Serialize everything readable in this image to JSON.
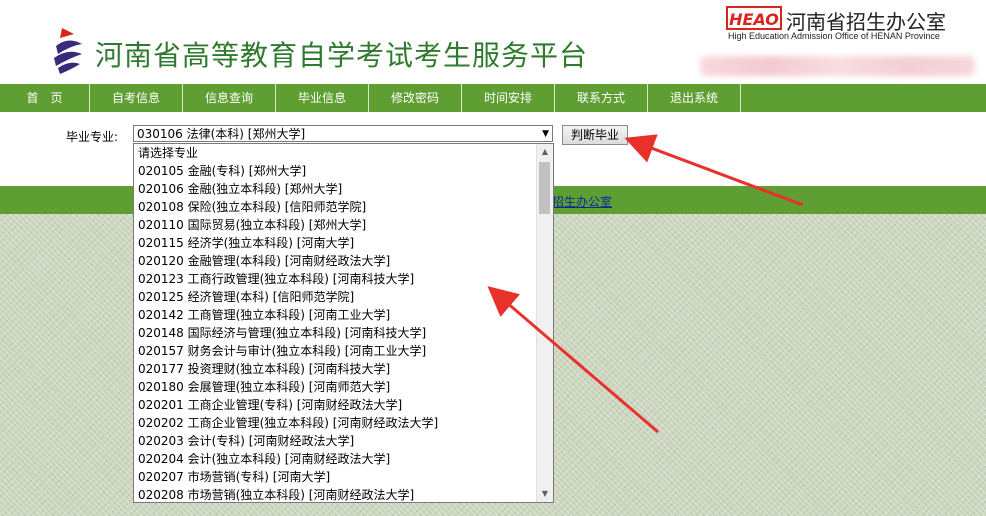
{
  "header": {
    "site_title": "河南省高等教育自学考试考生服务平台",
    "office_logo_text": "HEAO",
    "office_name_cn": "河南省招生办公室",
    "office_name_en": "High Education Admission Office of HENAN Province"
  },
  "nav": [
    {
      "label": "首　页",
      "width": 90
    },
    {
      "label": "自考信息",
      "width": 93
    },
    {
      "label": "信息查询",
      "width": 93
    },
    {
      "label": "毕业信息",
      "width": 93
    },
    {
      "label": "修改密码",
      "width": 93
    },
    {
      "label": "时间安排",
      "width": 93
    },
    {
      "label": "联系方式",
      "width": 93
    },
    {
      "label": "退出系统",
      "width": 93
    }
  ],
  "form": {
    "label": "毕业专业:",
    "selected_value": "030106 法律(本科) [郑州大学]",
    "judge_button": "判断毕业"
  },
  "footer": {
    "link_text": "招生办公室"
  },
  "dropdown_options": [
    "请选择专业",
    "020105 金融(专科) [郑州大学]",
    "020106 金融(独立本科段) [郑州大学]",
    "020108 保险(独立本科段) [信阳师范学院]",
    "020110 国际贸易(独立本科段) [郑州大学]",
    "020115 经济学(独立本科段) [河南大学]",
    "020120 金融管理(本科段) [河南财经政法大学]",
    "020123 工商行政管理(独立本科段) [河南科技大学]",
    "020125 经济管理(本科) [信阳师范学院]",
    "020142 工商管理(独立本科段) [河南工业大学]",
    "020148 国际经济与管理(独立本科段) [河南科技大学]",
    "020157 财务会计与审计(独立本科段) [河南工业大学]",
    "020177 投资理财(独立本科段) [河南科技大学]",
    "020180 会展管理(独立本科段) [河南师范大学]",
    "020201 工商企业管理(专科) [河南财经政法大学]",
    "020202 工商企业管理(独立本科段) [河南财经政法大学]",
    "020203 会计(专科) [河南财经政法大学]",
    "020204 会计(独立本科段) [河南财经政法大学]",
    "020207 市场营销(专科) [河南大学]",
    "020208 市场营销(独立本科段) [河南财经政法大学]"
  ],
  "colors": {
    "nav_green": "#5f9e32",
    "title_green": "#2f7a2f",
    "annotation_red": "#e8312a"
  }
}
